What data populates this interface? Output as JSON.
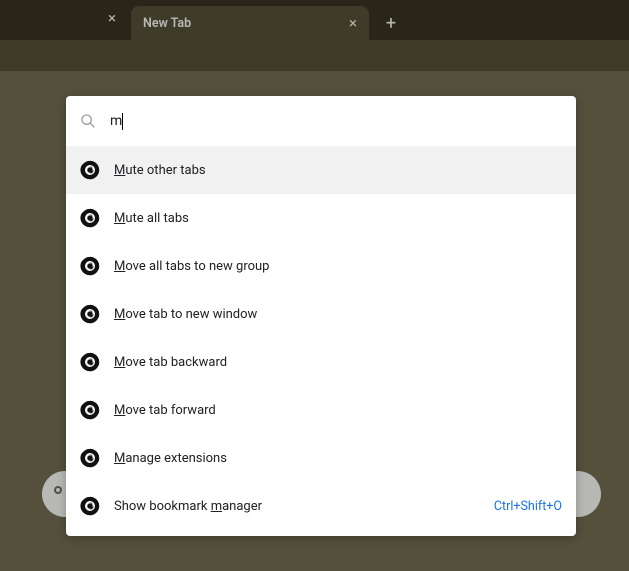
{
  "tabstrip": {
    "active_tab_title": "New Tab"
  },
  "search": {
    "value": "m",
    "placeholder": ""
  },
  "commands": [
    {
      "pre": "",
      "u": "M",
      "post": "ute other tabs",
      "shortcut": "",
      "highlight": true
    },
    {
      "pre": "",
      "u": "M",
      "post": "ute all tabs",
      "shortcut": "",
      "highlight": false
    },
    {
      "pre": "",
      "u": "M",
      "post": "ove all tabs to new group",
      "shortcut": "",
      "highlight": false
    },
    {
      "pre": "",
      "u": "M",
      "post": "ove tab to new window",
      "shortcut": "",
      "highlight": false
    },
    {
      "pre": "",
      "u": "M",
      "post": "ove tab backward",
      "shortcut": "",
      "highlight": false
    },
    {
      "pre": "",
      "u": "M",
      "post": "ove tab forward",
      "shortcut": "",
      "highlight": false
    },
    {
      "pre": "",
      "u": "M",
      "post": "anage extensions",
      "shortcut": "",
      "highlight": false
    },
    {
      "pre": "Show bookmark ",
      "u": "m",
      "post": "anager",
      "shortcut": "Ctrl+Shift+O",
      "highlight": false
    }
  ]
}
